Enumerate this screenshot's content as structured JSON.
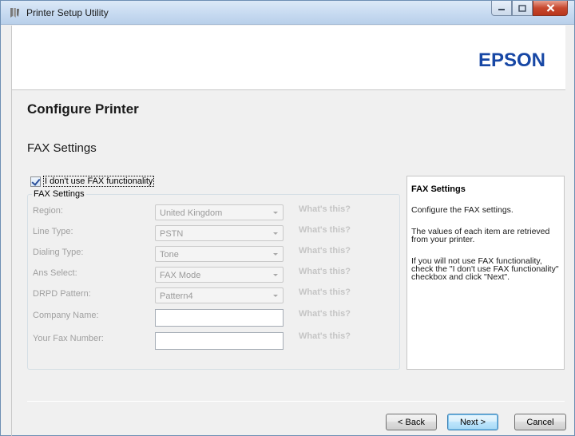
{
  "window": {
    "title": "Printer Setup Utility"
  },
  "brand": {
    "logo": "EPSON",
    "color": "#1747a5"
  },
  "page": {
    "heading": "Configure Printer",
    "subheading": "FAX Settings"
  },
  "checkbox": {
    "label": "I don't use FAX functionality",
    "checked": true
  },
  "fax_group": {
    "title": "FAX Settings",
    "rows": [
      {
        "label": "Region:",
        "type": "select",
        "value": "United Kingdom",
        "help": "What's this?"
      },
      {
        "label": "Line Type:",
        "type": "select",
        "value": "PSTN",
        "help": "What's this?"
      },
      {
        "label": "Dialing Type:",
        "type": "select",
        "value": "Tone",
        "help": "What's this?"
      },
      {
        "label": "Ans Select:",
        "type": "select",
        "value": "FAX Mode",
        "help": "What's this?"
      },
      {
        "label": "DRPD Pattern:",
        "type": "select",
        "value": "Pattern4",
        "help": "What's this?"
      },
      {
        "label": "Company Name:",
        "type": "text",
        "value": "",
        "help": "What's this?"
      },
      {
        "label": "Your Fax Number:",
        "type": "text",
        "value": "",
        "help": "What's this?"
      }
    ]
  },
  "help_panel": {
    "title": "FAX Settings",
    "p1": "Configure the FAX settings.",
    "p2": "The values of each item are retrieved from your printer.",
    "p3": "If you will not use FAX functionality, check the \"I don't use FAX functionality\" checkbox and click \"Next\"."
  },
  "buttons": {
    "back": "< Back",
    "next": "Next >",
    "cancel": "Cancel"
  },
  "icons": {
    "app": "printer-setup-icon",
    "minimize": "minimize-icon",
    "maximize": "maximize-icon",
    "close": "close-icon"
  }
}
